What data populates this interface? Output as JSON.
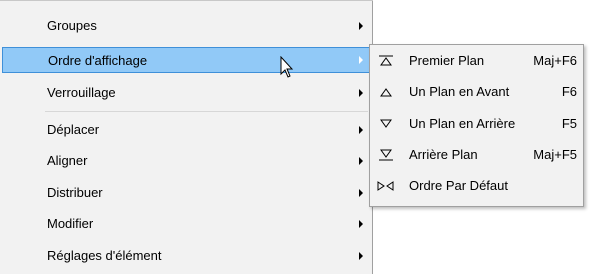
{
  "main_menu": {
    "items": [
      {
        "label": "Groupes",
        "has_submenu": true
      },
      {
        "label": "Ordre d'affichage",
        "has_submenu": true,
        "highlighted": true
      },
      {
        "label": "Verrouillage",
        "has_submenu": true
      },
      {
        "label": "Déplacer",
        "has_submenu": true
      },
      {
        "label": "Aligner",
        "has_submenu": true
      },
      {
        "label": "Distribuer",
        "has_submenu": true
      },
      {
        "label": "Modifier",
        "has_submenu": true
      },
      {
        "label": "Réglages d'élément",
        "has_submenu": true
      }
    ]
  },
  "submenu": {
    "items": [
      {
        "label": "Premier Plan",
        "shortcut": "Maj+F6",
        "icon": "bring-to-front-icon"
      },
      {
        "label": "Un Plan en Avant",
        "shortcut": "F6",
        "icon": "bring-forward-icon"
      },
      {
        "label": "Un Plan en Arrière",
        "shortcut": "F5",
        "icon": "send-backward-icon"
      },
      {
        "label": "Arrière Plan",
        "shortcut": "Maj+F5",
        "icon": "send-to-back-icon"
      },
      {
        "label": "Ordre Par Défaut",
        "shortcut": "",
        "icon": "default-order-icon"
      }
    ]
  },
  "colors": {
    "menu_bg": "#f2f2f2",
    "highlight_bg": "#91c9f7",
    "highlight_border": "#3f90d9",
    "border": "#a0a0a0"
  }
}
